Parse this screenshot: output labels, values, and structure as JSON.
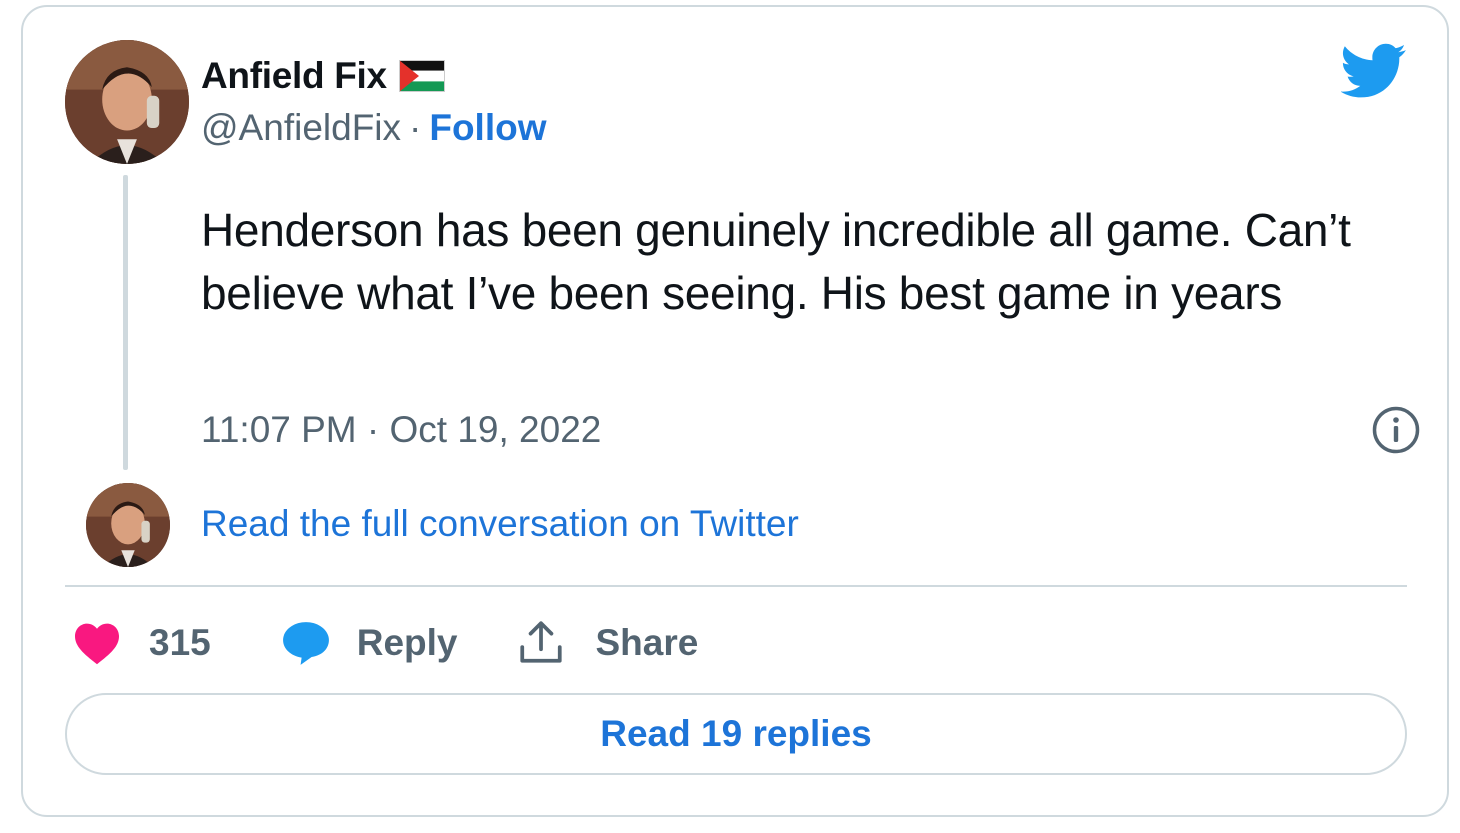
{
  "tweet": {
    "author": {
      "name": "Anfield Fix",
      "handle": "@AnfieldFix",
      "follow_label": "Follow",
      "flag_icon": "palestine-flag-icon"
    },
    "text": "Henderson has been genuinely incredible all game. Can’t believe what I’ve been seeing. His best game in years",
    "timestamp": "11:07 PM · Oct 19, 2022",
    "full_conversation_label": "Read the full conversation on Twitter",
    "actions": {
      "likes_count": "315",
      "reply_label": "Reply",
      "share_label": "Share"
    },
    "read_replies_label": "Read 19 replies",
    "icons": [
      "twitter-bird-icon",
      "info-icon",
      "heart-icon",
      "reply-bubble-icon",
      "share-icon"
    ]
  },
  "colors": {
    "twitter_blue": "#1d9bf0",
    "link_blue": "#1d74d8",
    "heart_pink": "#f91880",
    "muted_text": "#536471",
    "border": "#cfd9de"
  }
}
